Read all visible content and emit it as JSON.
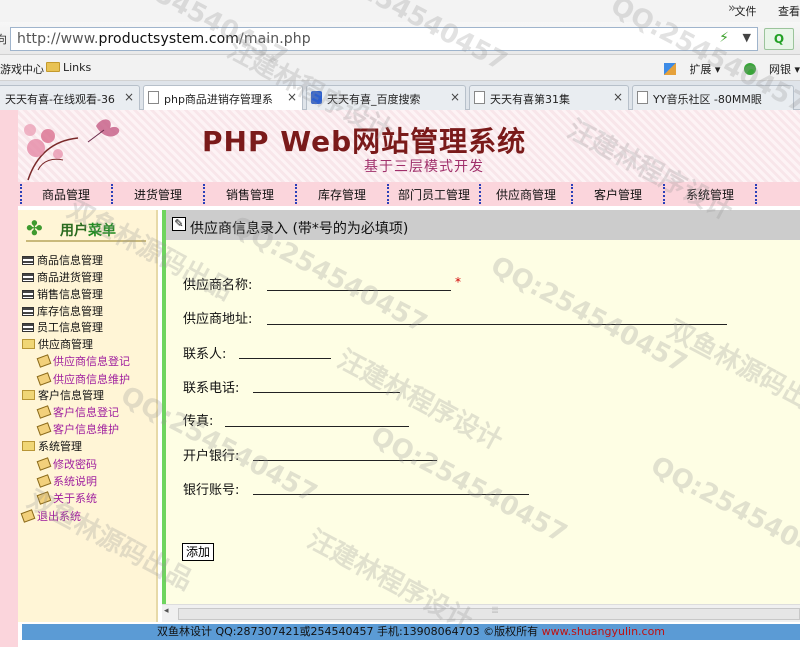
{
  "browser": {
    "menu": [
      "文件",
      "查看"
    ],
    "address_prefix": "向",
    "url_host": "http://www.",
    "url_domain": "productsystem.com",
    "url_path": "/main.php",
    "search_button": "Q",
    "favorites": [
      "游戏中心",
      "Links"
    ],
    "toolbar": [
      "扩展",
      "网银"
    ],
    "tabs": [
      {
        "label": "天天有喜-在线观看-36"
      },
      {
        "label": "php商品进销存管理系"
      },
      {
        "label": "天天有喜_百度搜索"
      },
      {
        "label": "天天有喜第31集"
      },
      {
        "label": "YY音乐社区 -80MM眼"
      }
    ],
    "tab_close": "×"
  },
  "site": {
    "title": "PHP Web网站管理系统",
    "subtitle": "基于三层模式开发",
    "nav": [
      "商品管理",
      "进货管理",
      "销售管理",
      "库存管理",
      "部门员工管理",
      "供应商管理",
      "客户管理",
      "系统管理"
    ]
  },
  "sidebar": {
    "title_a": "用户",
    "title_b": "菜单",
    "items": [
      {
        "label": "商品信息管理",
        "type": "list"
      },
      {
        "label": "商品进货管理",
        "type": "list"
      },
      {
        "label": "销售信息管理",
        "type": "list"
      },
      {
        "label": "库存信息管理",
        "type": "list"
      },
      {
        "label": "员工信息管理",
        "type": "list"
      },
      {
        "label": "供应商管理",
        "type": "folder"
      },
      {
        "label": "供应商信息登记",
        "type": "sub"
      },
      {
        "label": "供应商信息维护",
        "type": "sub"
      },
      {
        "label": "客户信息管理",
        "type": "folder"
      },
      {
        "label": "客户信息登记",
        "type": "sub"
      },
      {
        "label": "客户信息维护",
        "type": "sub"
      },
      {
        "label": "系统管理",
        "type": "folder"
      },
      {
        "label": "修改密码",
        "type": "sub"
      },
      {
        "label": "系统说明",
        "type": "sub"
      },
      {
        "label": "关于系统",
        "type": "sub"
      },
      {
        "label": "退出系统",
        "type": "exit"
      }
    ]
  },
  "form": {
    "heading": "供应商信息录入 (带*号的为必填项)",
    "required_mark": "*",
    "fields": [
      {
        "label": "供应商名称:",
        "value": ""
      },
      {
        "label": "供应商地址:",
        "value": ""
      },
      {
        "label": "联系人:",
        "value": ""
      },
      {
        "label": "联系电话:",
        "value": ""
      },
      {
        "label": "传真:",
        "value": ""
      },
      {
        "label": "开户银行:",
        "value": ""
      },
      {
        "label": "银行账号:",
        "value": ""
      }
    ],
    "submit_label": "添加"
  },
  "footer": {
    "text": "双鱼林设计 QQ:287307421或254540457 手机:13908064703 ©版权所有 ",
    "link": "www.shuangyulin.com"
  },
  "watermarks": [
    "QQ:254540457",
    "汪建林程序设计",
    "双鱼林源码出品"
  ],
  "colors": {
    "nav_bg": "#fbd5dc",
    "sidebar_bg": "#fff5d6",
    "content_bg": "#fefee4",
    "accent_green": "#6fd55f",
    "footer_bg": "#5b9bd5",
    "title_color": "#7a1a1a"
  }
}
